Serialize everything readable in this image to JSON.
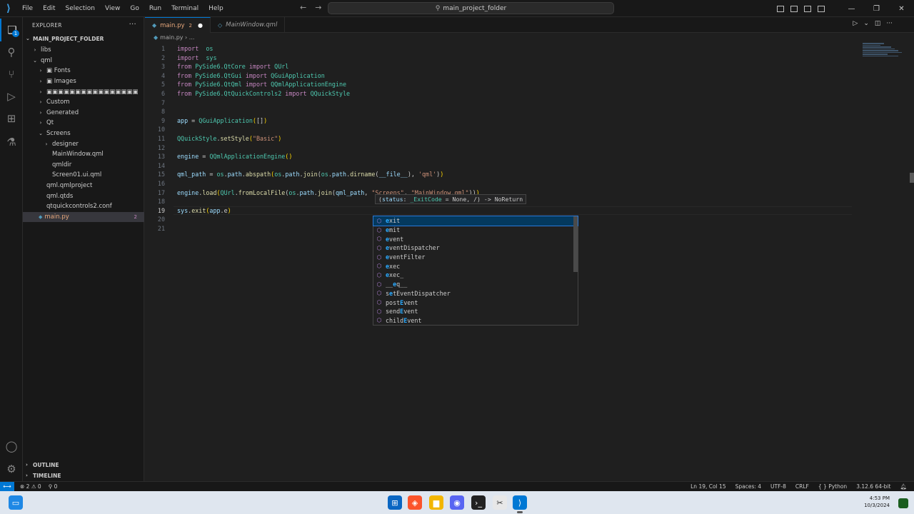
{
  "menu": [
    "File",
    "Edit",
    "Selection",
    "View",
    "Go",
    "Run",
    "Terminal",
    "Help"
  ],
  "search": {
    "label": "main_project_folder"
  },
  "sidebar": {
    "title": "EXPLORER",
    "folder": "MAIN_PROJECT_FOLDER",
    "tree": [
      {
        "label": "libs",
        "chev": "›",
        "depth": 1
      },
      {
        "label": "qml",
        "chev": "⌄",
        "depth": 1
      },
      {
        "label": "▣               Fonts",
        "chev": "›",
        "depth": 2
      },
      {
        "label": "▣               Images",
        "chev": "›",
        "depth": 2
      },
      {
        "label": "▣▣▣▣▣▣▣▣▣▣▣▣▣▣▣▣",
        "chev": "›",
        "depth": 2
      },
      {
        "label": "Custom",
        "chev": "›",
        "depth": 2
      },
      {
        "label": "Generated",
        "chev": "›",
        "depth": 2
      },
      {
        "label": "Qt",
        "chev": "›",
        "depth": 2
      },
      {
        "label": "Screens",
        "chev": "⌄",
        "depth": 2
      },
      {
        "label": "designer",
        "chev": "›",
        "depth": 3
      },
      {
        "label": "MainWindow.qml",
        "chev": "",
        "depth": 3
      },
      {
        "label": "qmldir",
        "chev": "",
        "depth": 3
      },
      {
        "label": "Screen01.ui.qml",
        "chev": "",
        "depth": 3
      },
      {
        "label": "qml.qmlproject",
        "chev": "",
        "depth": 2
      },
      {
        "label": "qml.qtds",
        "chev": "",
        "depth": 2
      },
      {
        "label": "qtquickcontrols2.conf",
        "chev": "",
        "depth": 2
      },
      {
        "label": "main.py",
        "chev": "",
        "depth": 1,
        "selected": true,
        "count": "2"
      }
    ],
    "outline": "OUTLINE",
    "timeline": "TIMELINE"
  },
  "tabs": [
    {
      "label": "main.py",
      "count": "2",
      "active": true
    },
    {
      "label": "MainWindow.qml",
      "active": false
    }
  ],
  "breadcrumb": "main.py › ...",
  "code": [
    [
      [
        "kw",
        "import"
      ],
      [
        "",
        "  "
      ],
      [
        "mod",
        "os"
      ]
    ],
    [
      [
        "kw",
        "import"
      ],
      [
        "",
        "  "
      ],
      [
        "mod",
        "sys"
      ]
    ],
    [
      [
        "kw",
        "from"
      ],
      [
        "",
        " "
      ],
      [
        "mod",
        "PySide6.QtCore"
      ],
      [
        "",
        " "
      ],
      [
        "kw",
        "import"
      ],
      [
        "",
        " "
      ],
      [
        "cls",
        "QUrl"
      ]
    ],
    [
      [
        "kw",
        "from"
      ],
      [
        "",
        " "
      ],
      [
        "mod",
        "PySide6.QtGui"
      ],
      [
        "",
        " "
      ],
      [
        "kw",
        "import"
      ],
      [
        "",
        " "
      ],
      [
        "cls",
        "QGuiApplication"
      ]
    ],
    [
      [
        "kw",
        "from"
      ],
      [
        "",
        " "
      ],
      [
        "mod",
        "PySide6.QtQml"
      ],
      [
        "",
        " "
      ],
      [
        "kw",
        "import"
      ],
      [
        "",
        " "
      ],
      [
        "cls",
        "QQmlApplicationEngine"
      ]
    ],
    [
      [
        "kw",
        "from"
      ],
      [
        "",
        " "
      ],
      [
        "mod",
        "PySide6.QtQuickControls2"
      ],
      [
        "",
        " "
      ],
      [
        "kw",
        "import"
      ],
      [
        "",
        " "
      ],
      [
        "cls",
        "QQuickStyle"
      ]
    ],
    [],
    [],
    [
      [
        "var",
        "app"
      ],
      [
        "",
        " = "
      ],
      [
        "cls",
        "QGuiApplication"
      ],
      [
        "yb",
        "("
      ],
      [
        "",
        "[]"
      ],
      [
        "yb",
        ")"
      ]
    ],
    [],
    [
      [
        "cls",
        "QQuickStyle"
      ],
      [
        "",
        "."
      ],
      [
        "fn",
        "setStyle"
      ],
      [
        "yb",
        "("
      ],
      [
        "str",
        "\"Basic\""
      ],
      [
        "yb",
        ")"
      ]
    ],
    [],
    [
      [
        "var",
        "engine"
      ],
      [
        "",
        " = "
      ],
      [
        "cls",
        "QQmlApplicationEngine"
      ],
      [
        "yb",
        "()"
      ]
    ],
    [],
    [
      [
        "var",
        "qml_path"
      ],
      [
        "",
        " = "
      ],
      [
        "mod",
        "os"
      ],
      [
        "",
        "."
      ],
      [
        "var",
        "path"
      ],
      [
        "",
        "."
      ],
      [
        "fn",
        "abspath"
      ],
      [
        "yb",
        "("
      ],
      [
        "mod",
        "os"
      ],
      [
        "",
        "."
      ],
      [
        "var",
        "path"
      ],
      [
        "",
        "."
      ],
      [
        "fn",
        "join"
      ],
      [
        "",
        "("
      ],
      [
        "mod",
        "os"
      ],
      [
        "",
        "."
      ],
      [
        "var",
        "path"
      ],
      [
        "",
        "."
      ],
      [
        "fn",
        "dirname"
      ],
      [
        "",
        "("
      ],
      [
        "var",
        "__file__"
      ],
      [
        "",
        "), "
      ],
      [
        "str",
        "'qml'"
      ],
      [
        "",
        ")"
      ],
      [
        "yb",
        ")"
      ]
    ],
    [],
    [
      [
        "var",
        "engine"
      ],
      [
        "",
        "."
      ],
      [
        "fn",
        "load"
      ],
      [
        "yb",
        "("
      ],
      [
        "cls",
        "QUrl"
      ],
      [
        "",
        "."
      ],
      [
        "fn",
        "fromLocalFile"
      ],
      [
        "",
        "("
      ],
      [
        "mod",
        "os"
      ],
      [
        "",
        "."
      ],
      [
        "var",
        "path"
      ],
      [
        "",
        "."
      ],
      [
        "fn",
        "join"
      ],
      [
        "",
        "("
      ],
      [
        "var",
        "qml_path"
      ],
      [
        "",
        ", "
      ],
      [
        "str",
        "\"Screens\""
      ],
      [
        "",
        ", "
      ],
      [
        "str",
        "\"MainWindow.qml\""
      ],
      [
        "",
        "))"
      ],
      [
        "yb",
        ")"
      ]
    ],
    [],
    [
      [
        "var",
        "sys"
      ],
      [
        "",
        "."
      ],
      [
        "fn",
        "exit"
      ],
      [
        "yb",
        "("
      ],
      [
        "var",
        "app"
      ],
      [
        "",
        ".e"
      ],
      [
        "yb",
        ")"
      ]
    ],
    [],
    []
  ],
  "hint": {
    "pre": "(",
    "param": "status",
    "mid": ": ",
    "type": "_ExitCode",
    "post": " = None, /) -> NoReturn"
  },
  "suggestions": [
    {
      "pre": "",
      "hl": "e",
      "post": "xit",
      "selected": true
    },
    {
      "pre": "",
      "hl": "e",
      "post": "mit"
    },
    {
      "pre": "",
      "hl": "e",
      "post": "vent"
    },
    {
      "pre": "",
      "hl": "e",
      "post": "ventDispatcher"
    },
    {
      "pre": "",
      "hl": "e",
      "post": "ventFilter"
    },
    {
      "pre": "",
      "hl": "e",
      "post": "xec"
    },
    {
      "pre": "",
      "hl": "e",
      "post": "xec_"
    },
    {
      "pre": "__",
      "hl": "e",
      "post": "q__"
    },
    {
      "pre": "s",
      "hl": "e",
      "post": "tEventDispatcher"
    },
    {
      "pre": "post",
      "hl": "E",
      "post": "vent"
    },
    {
      "pre": "send",
      "hl": "E",
      "post": "vent"
    },
    {
      "pre": "child",
      "hl": "E",
      "post": "vent"
    }
  ],
  "status": {
    "errors": "⊗ 2 ⚠ 0",
    "ports": "⚲ 0",
    "position": "Ln 19, Col 15",
    "spaces": "Spaces: 4",
    "encoding": "UTF-8",
    "eol": "CRLF",
    "language": "Python",
    "interpreter": "3.12.6 64-bit"
  },
  "clock": {
    "time": "4:53 PM",
    "date": "10/3/2024"
  },
  "colors": {
    "accent": "#0078d4",
    "background": "#1f1f1f",
    "sidebar": "#181818"
  }
}
